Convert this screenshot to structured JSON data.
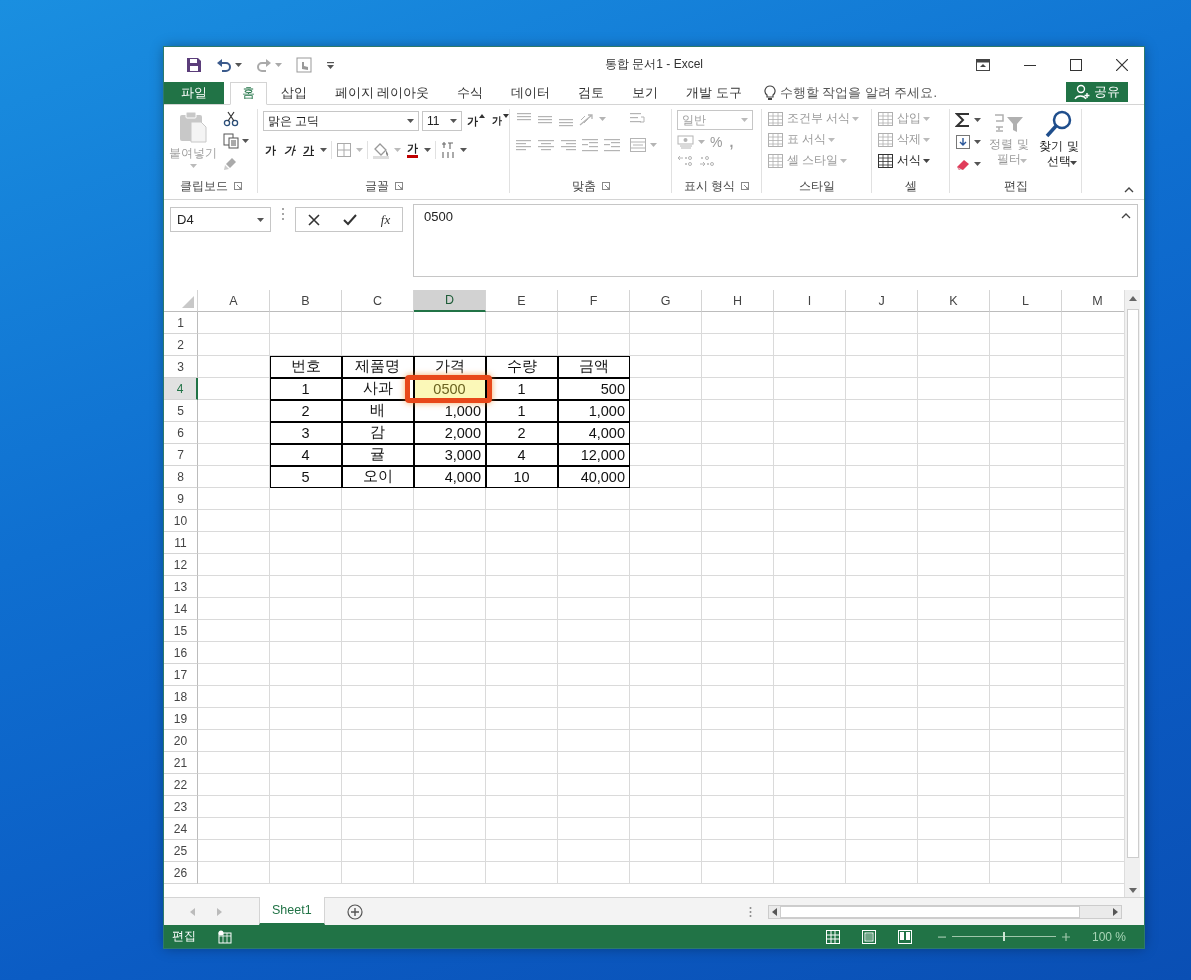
{
  "title_bar": {
    "title": "통합 문서1 - Excel"
  },
  "tabs": [
    {
      "label": "파일",
      "kind": "file",
      "selected": false
    },
    {
      "label": "홈",
      "kind": "tab",
      "selected": true
    },
    {
      "label": "삽입",
      "kind": "tab",
      "selected": false
    },
    {
      "label": "페이지 레이아웃",
      "kind": "tab",
      "selected": false
    },
    {
      "label": "수식",
      "kind": "tab",
      "selected": false
    },
    {
      "label": "데이터",
      "kind": "tab",
      "selected": false
    },
    {
      "label": "검토",
      "kind": "tab",
      "selected": false
    },
    {
      "label": "보기",
      "kind": "tab",
      "selected": false
    },
    {
      "label": "개발 도구",
      "kind": "tab",
      "selected": false
    }
  ],
  "tell_me": {
    "text": "수행할 작업을 알려 주세요."
  },
  "share_button": {
    "label": "공유"
  },
  "ribbon": {
    "groups": [
      {
        "kind": "clipboard",
        "label": "클립보드",
        "paste": {
          "label": "붙여넣기",
          "disabled": true
        }
      },
      {
        "kind": "font",
        "label": "글꼴",
        "font_name": "맑은 고딕",
        "font_size": "11",
        "grow": "가",
        "shrink": "가",
        "bold": "가",
        "italic": "가",
        "underline": "가",
        "font_color": "가"
      },
      {
        "kind": "alignment",
        "label": "맞춤",
        "disabled": true
      },
      {
        "kind": "number",
        "label": "표시 형식",
        "disabled": true,
        "format": "일반",
        "percent": "%",
        "comma": ","
      },
      {
        "kind": "styles",
        "label": "스타일",
        "items": [
          {
            "label": "조건부 서식",
            "disabled": true
          },
          {
            "label": "표 서식",
            "disabled": true
          },
          {
            "label": "셀 스타일",
            "disabled": true
          }
        ]
      },
      {
        "kind": "cells",
        "label": "셀",
        "items": [
          {
            "label": "삽입",
            "disabled": true
          },
          {
            "label": "삭제",
            "disabled": true
          },
          {
            "label": "서식",
            "disabled": false
          }
        ]
      },
      {
        "kind": "editing",
        "label": "편집",
        "items": [
          {
            "label": "정렬 및 필터",
            "disabled": true
          },
          {
            "label": "찾기 및 선택",
            "disabled": false
          }
        ]
      }
    ]
  },
  "formula_bar": {
    "name_box": "D4",
    "insert_function": "fx",
    "formula": "0500"
  },
  "sheet": {
    "columns": [
      {
        "label": "A",
        "selected": false
      },
      {
        "label": "B",
        "selected": false
      },
      {
        "label": "C",
        "selected": false
      },
      {
        "label": "D",
        "selected": true
      },
      {
        "label": "E",
        "selected": false
      },
      {
        "label": "F",
        "selected": false
      },
      {
        "label": "G",
        "selected": false
      },
      {
        "label": "H",
        "selected": false
      },
      {
        "label": "I",
        "selected": false
      },
      {
        "label": "J",
        "selected": false
      },
      {
        "label": "K",
        "selected": false
      },
      {
        "label": "L",
        "selected": false
      },
      {
        "label": "M",
        "selected": false
      }
    ],
    "rows": [
      {
        "label": "1",
        "selected": false
      },
      {
        "label": "2",
        "selected": false
      },
      {
        "label": "3",
        "selected": false,
        "cells": [
          null,
          {
            "text": "번호",
            "kind": "label"
          },
          {
            "text": "제품명",
            "kind": "label"
          },
          {
            "text": "가격",
            "kind": "label"
          },
          {
            "text": "수량",
            "kind": "label"
          },
          {
            "text": "금액",
            "kind": "label"
          }
        ]
      },
      {
        "label": "4",
        "selected": true,
        "cells": [
          null,
          {
            "text": "1",
            "kind": "label"
          },
          {
            "text": "사과",
            "kind": "label"
          },
          {
            "text": "0500",
            "kind": "label",
            "editing": true,
            "highlighted": true
          },
          {
            "text": "1",
            "kind": "label"
          },
          {
            "text": "500",
            "kind": "amount"
          }
        ]
      },
      {
        "label": "5",
        "selected": false,
        "cells": [
          null,
          {
            "text": "2",
            "kind": "label"
          },
          {
            "text": "배",
            "kind": "label"
          },
          {
            "text": "1,000",
            "kind": "amount"
          },
          {
            "text": "1",
            "kind": "label"
          },
          {
            "text": "1,000",
            "kind": "amount"
          }
        ]
      },
      {
        "label": "6",
        "selected": false,
        "cells": [
          null,
          {
            "text": "3",
            "kind": "label"
          },
          {
            "text": "감",
            "kind": "label"
          },
          {
            "text": "2,000",
            "kind": "amount"
          },
          {
            "text": "2",
            "kind": "label"
          },
          {
            "text": "4,000",
            "kind": "amount"
          }
        ]
      },
      {
        "label": "7",
        "selected": false,
        "cells": [
          null,
          {
            "text": "4",
            "kind": "label"
          },
          {
            "text": "귤",
            "kind": "label"
          },
          {
            "text": "3,000",
            "kind": "amount"
          },
          {
            "text": "4",
            "kind": "label"
          },
          {
            "text": "12,000",
            "kind": "amount"
          }
        ]
      },
      {
        "label": "8",
        "selected": false,
        "cells": [
          null,
          {
            "text": "5",
            "kind": "label"
          },
          {
            "text": "오이",
            "kind": "label"
          },
          {
            "text": "4,000",
            "kind": "amount"
          },
          {
            "text": "10",
            "kind": "label"
          },
          {
            "text": "40,000",
            "kind": "amount"
          }
        ]
      },
      {
        "label": "9",
        "selected": false
      },
      {
        "label": "10",
        "selected": false
      },
      {
        "label": "11",
        "selected": false
      },
      {
        "label": "12",
        "selected": false
      },
      {
        "label": "13",
        "selected": false
      },
      {
        "label": "14",
        "selected": false
      },
      {
        "label": "15",
        "selected": false
      },
      {
        "label": "16",
        "selected": false
      },
      {
        "label": "17",
        "selected": false
      },
      {
        "label": "18",
        "selected": false
      },
      {
        "label": "19",
        "selected": false
      },
      {
        "label": "20",
        "selected": false
      },
      {
        "label": "21",
        "selected": false
      },
      {
        "label": "22",
        "selected": false
      },
      {
        "label": "23",
        "selected": false
      },
      {
        "label": "24",
        "selected": false
      },
      {
        "label": "25",
        "selected": false
      },
      {
        "label": "26",
        "selected": false
      }
    ]
  },
  "sheet_tabs": [
    {
      "label": "Sheet1",
      "selected": true
    }
  ],
  "status_bar": {
    "mode": "편집",
    "zoom_slider": {
      "level": 0.5
    },
    "zoom": "100 %"
  }
}
